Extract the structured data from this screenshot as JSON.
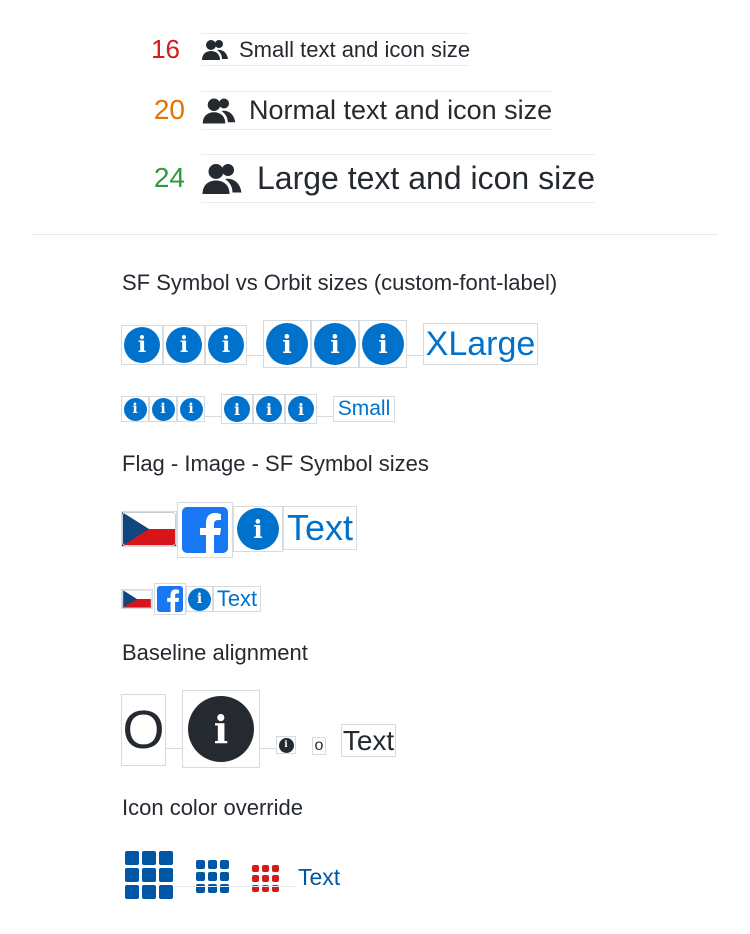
{
  "size_rows": [
    {
      "number": "16",
      "number_color": "#d21c1c",
      "label": "Small text and icon size",
      "icon": "people-icon"
    },
    {
      "number": "20",
      "number_color": "#e67300",
      "label": "Normal text and icon size",
      "icon": "people-icon"
    },
    {
      "number": "24",
      "number_color": "#2b9c3d",
      "label": "Large text and icon size",
      "icon": "people-icon"
    }
  ],
  "sections": {
    "sf_vs_orbit": "SF Symbol vs Orbit sizes (custom-font-label)",
    "flag_image_sf": "Flag - Image - SF Symbol sizes",
    "baseline": "Baseline alignment",
    "icon_color": "Icon color override"
  },
  "sf_vs_orbit_rows": {
    "xlarge_label": "XLarge",
    "small_label": "Small",
    "icon": "info-icon"
  },
  "flag_rows": {
    "large_text": "Text",
    "small_text": "Text",
    "flag": "czech-flag-icon",
    "image": "facebook-icon"
  },
  "baseline_row": {
    "big_letter": "O",
    "small_letter": "o",
    "text": "Text",
    "info_glyph": "i"
  },
  "icon_color_row": {
    "text": "Text",
    "icon": "grid-icon",
    "colors": {
      "primary": "#0057a5",
      "override": "#d21c1c",
      "text": "#0057a5"
    }
  },
  "colors": {
    "accent": "#0172cb",
    "ink": "#252a31",
    "divider": "#e6e9ec"
  }
}
